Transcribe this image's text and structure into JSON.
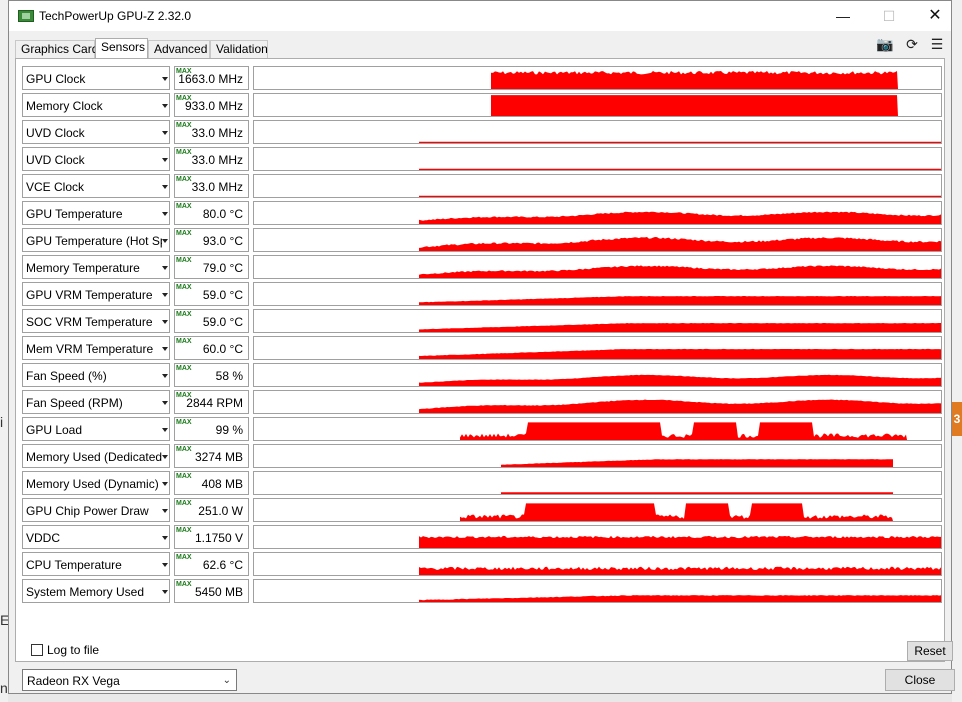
{
  "window": {
    "title": "TechPowerUp GPU-Z 2.32.0",
    "minimize_glyph": "—",
    "maximize_glyph": "☐",
    "close_glyph": "✕"
  },
  "tabs": [
    {
      "label": "Graphics Card"
    },
    {
      "label": "Sensors",
      "active": true
    },
    {
      "label": "Advanced"
    },
    {
      "label": "Validation"
    }
  ],
  "toolbar": {
    "camera_glyph": "📷",
    "refresh_glyph": "⟳",
    "menu_glyph": "☰"
  },
  "max_tag": "MAX",
  "graph_color": "#ff0000",
  "sensors": [
    {
      "label": "GPU Clock",
      "value": "1663.0 MHz"
    },
    {
      "label": "Memory Clock",
      "value": "933.0 MHz"
    },
    {
      "label": "UVD Clock",
      "value": "33.0 MHz"
    },
    {
      "label": "UVD Clock",
      "value": "33.0 MHz"
    },
    {
      "label": "VCE Clock",
      "value": "33.0 MHz"
    },
    {
      "label": "GPU Temperature",
      "value": "80.0 °C"
    },
    {
      "label": "GPU Temperature (Hot Spot)",
      "value": "93.0 °C"
    },
    {
      "label": "Memory Temperature",
      "value": "79.0 °C"
    },
    {
      "label": "GPU VRM Temperature",
      "value": "59.0 °C"
    },
    {
      "label": "SOC VRM Temperature",
      "value": "59.0 °C"
    },
    {
      "label": "Mem VRM Temperature",
      "value": "60.0 °C"
    },
    {
      "label": "Fan Speed (%)",
      "value": "58 %"
    },
    {
      "label": "Fan Speed (RPM)",
      "value": "2844 RPM"
    },
    {
      "label": "GPU Load",
      "value": "99 %"
    },
    {
      "label": "Memory Used (Dedicated)",
      "value": "3274 MB"
    },
    {
      "label": "Memory Used (Dynamic)",
      "value": "408 MB"
    },
    {
      "label": "GPU Chip Power Draw",
      "value": "251.0 W"
    },
    {
      "label": "VDDC",
      "value": "1.1750 V"
    },
    {
      "label": "CPU Temperature",
      "value": "62.6 °C"
    },
    {
      "label": "System Memory Used",
      "value": "5450 MB"
    }
  ],
  "footer": {
    "log_label": "Log to file",
    "log_checked": false,
    "reset_label": "Reset",
    "gpu_selected": "Radeon RX Vega",
    "close_label": "Close"
  },
  "background": {
    "edge_letters": [
      "i",
      "E",
      "n"
    ],
    "orange_tab_text": "3"
  }
}
